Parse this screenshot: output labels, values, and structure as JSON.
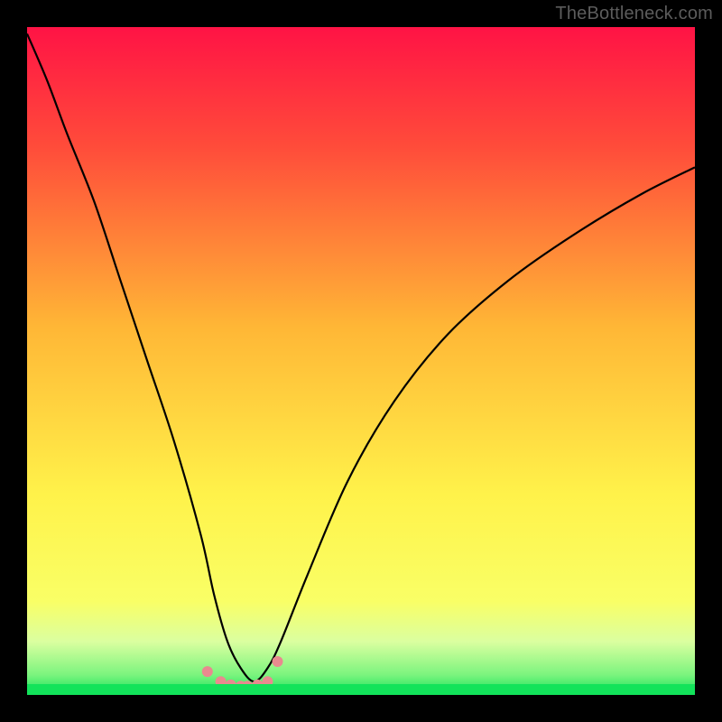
{
  "watermark": "TheBottleneck.com",
  "chart_data": {
    "type": "line",
    "title": "",
    "xlabel": "",
    "ylabel": "",
    "ylim": [
      0,
      100
    ],
    "xlim": [
      0,
      100
    ],
    "gradient_stops": [
      {
        "pct": 0,
        "color": "#ff1345"
      },
      {
        "pct": 18,
        "color": "#ff4c3a"
      },
      {
        "pct": 45,
        "color": "#ffb736"
      },
      {
        "pct": 70,
        "color": "#fff24a"
      },
      {
        "pct": 86,
        "color": "#f9ff66"
      },
      {
        "pct": 92,
        "color": "#dbffa0"
      },
      {
        "pct": 97,
        "color": "#7bf47e"
      },
      {
        "pct": 100,
        "color": "#12e35a"
      }
    ],
    "series": [
      {
        "name": "bottleneck_curve",
        "color": "#000000",
        "x": [
          0,
          3,
          6,
          10,
          14,
          18,
          22,
          26,
          28,
          30,
          32,
          34,
          36,
          38,
          42,
          48,
          55,
          63,
          72,
          82,
          92,
          100
        ],
        "y": [
          1,
          8,
          16,
          26,
          38,
          50,
          62,
          76,
          85,
          92,
          96,
          98,
          96,
          92,
          82,
          68,
          56,
          46,
          38,
          31,
          25,
          21
        ]
      },
      {
        "name": "markers",
        "color": "#e98a8f",
        "type": "scatter",
        "x": [
          27,
          29,
          30.5,
          32,
          33,
          34.5,
          36,
          37.5
        ],
        "y": [
          96.5,
          98,
          98.5,
          98.7,
          98.7,
          98.5,
          98,
          95
        ]
      }
    ],
    "note": "x and y expressed as percent of plot width/height; y=0 is top, y=100 is bottom (green)."
  }
}
